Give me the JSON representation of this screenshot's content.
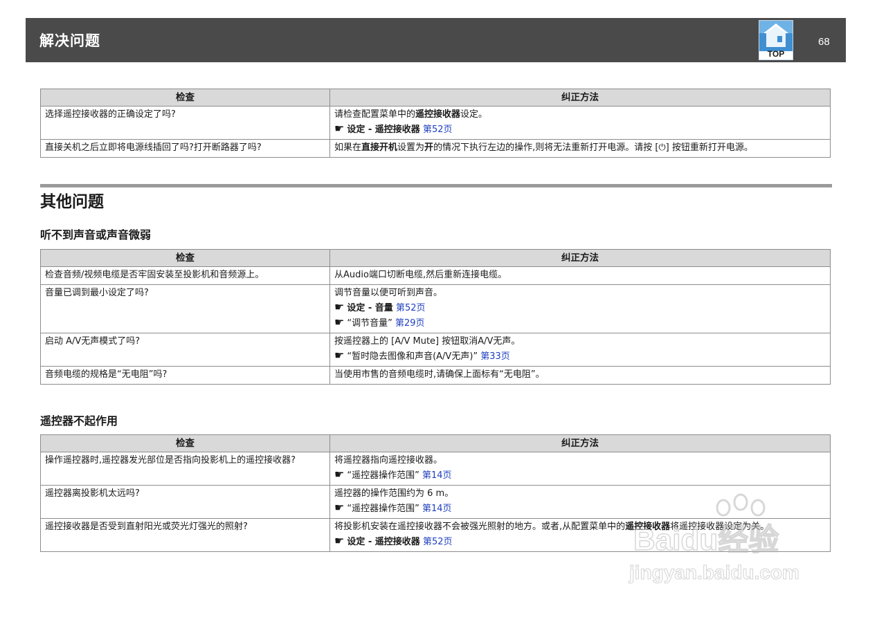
{
  "header": {
    "title": "解决问题",
    "top_label": "TOP",
    "page_number": "68"
  },
  "table_headers": {
    "check": "检查",
    "fix": "纠正方法"
  },
  "table1": {
    "rows": [
      {
        "check": "选择遥控接收器的正确设定了吗?",
        "fix": {
          "pre": "请检查配置菜单中的",
          "bold": "遥控接收器",
          "post": "设定。"
        },
        "refs": [
          {
            "hand": "☛",
            "text": "设定 - 遥控接收器",
            "link": "第52页"
          }
        ]
      },
      {
        "check": "直接关机之后立即将电源线插回了吗?打开断路器了吗?",
        "fix": {
          "p1": "如果在",
          "b1": "直接开机",
          "p2": "设置为",
          "b2": "开",
          "p3": "的情况下执行左边的操作,则将无法重新打开电源。请按 [⏻] 按钮重新打开电源。"
        }
      }
    ]
  },
  "section_title": "其他问题",
  "sub1": {
    "title": "听不到声音或声音微弱",
    "rows": [
      {
        "check": "检查音频/视频电缆是否牢固安装至投影机和音频源上。",
        "fix": "从Audio端口切断电缆,然后重新连接电缆。"
      },
      {
        "check": "音量已调到最小设定了吗?",
        "fix": "调节音量以便可听到声音。",
        "refs": [
          {
            "hand": "☛",
            "text": "设定 - 音量",
            "link": "第52页"
          },
          {
            "hand": "☛",
            "text": "“调节音量”",
            "link": "第29页"
          }
        ]
      },
      {
        "check": "启动 A/V无声模式了吗?",
        "fix": "按遥控器上的 [A/V Mute] 按钮取消A/V无声。",
        "refs": [
          {
            "hand": "☛",
            "text": "“暂时隐去图像和声音(A/V无声)”",
            "link": "第33页"
          }
        ]
      },
      {
        "check": "音频电缆的规格是“无电阻”吗?",
        "fix": "当使用市售的音频电缆时,请确保上面标有“无电阻”。"
      }
    ]
  },
  "sub2": {
    "title": "遥控器不起作用",
    "rows": [
      {
        "check": "操作遥控器时,遥控器发光部位是否指向投影机上的遥控接收器?",
        "fix": "将遥控器指向遥控接收器。",
        "refs": [
          {
            "hand": "☛",
            "text": "“遥控器操作范围”",
            "link": "第14页"
          }
        ]
      },
      {
        "check": "遥控器离投影机太远吗?",
        "fix": "遥控器的操作范围约为 6 m。",
        "refs": [
          {
            "hand": "☛",
            "text": "“遥控器操作范围”",
            "link": "第14页"
          }
        ]
      },
      {
        "check": "遥控接收器是否受到直射阳光或荧光灯强光的照射?",
        "fix": {
          "p1": "将投影机安装在遥控接收器不会被强光照射的地方。或者,从配置菜单中的",
          "b1": "遥控接收器",
          "p2": "将遥控接收器设定为关。"
        },
        "refs": [
          {
            "hand": "☛",
            "text": "设定 - 遥控接收器",
            "link": "第52页"
          }
        ]
      }
    ]
  },
  "watermark": {
    "line1": "Baidu经验",
    "line2": "jingyan.baidu.com"
  },
  "colors": {
    "header_bg": "#4a4a4a",
    "table_header_bg": "#d9d9d9",
    "link": "#1f3fbf",
    "rule": "#9a9a9a"
  },
  "icons": {
    "top_button": "house-icon",
    "pointer": "pointing-hand-icon"
  }
}
